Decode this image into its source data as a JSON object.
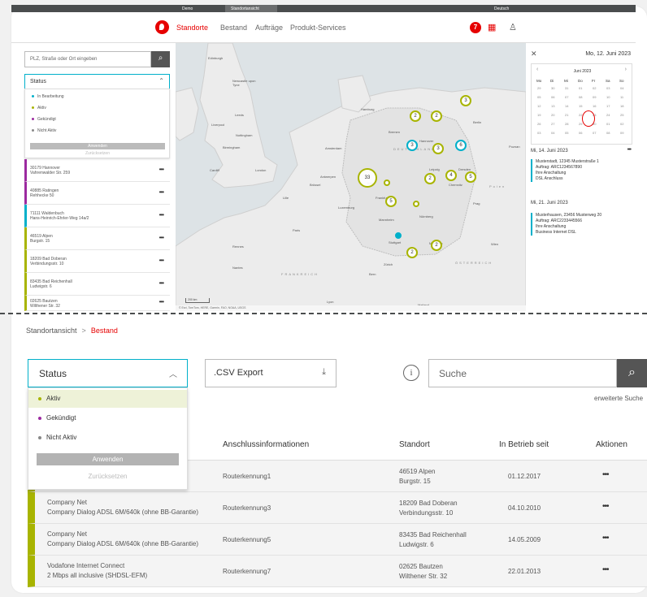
{
  "topbar": {
    "brand": "Demo",
    "tab": "Standortansicht",
    "language": "Deutsch"
  },
  "nav": {
    "items": [
      "Standorte",
      "Bestand",
      "Aufträge",
      "Produkt-Services"
    ],
    "badge_count": "7",
    "colors": {
      "brand": "#e60000",
      "accent": "#00b0ca",
      "active_green": "#a8b400",
      "cancelled_purple": "#9c2aa0"
    }
  },
  "mini": {
    "search_placeholder": "PLZ, Straße oder Ort eingeben",
    "status_label": "Status",
    "status_options": [
      "In Bearbeitung",
      "Aktiv",
      "Gekündigt",
      "Nicht Aktiv"
    ],
    "apply": "Anwenden",
    "reset": "Zurücksetzen",
    "locations": [
      {
        "l1": "30179 Hannover",
        "l2": "Vahrenwalder Str. 259"
      },
      {
        "l1": "40885 Ratingen",
        "l2": "Rehhecke 50"
      },
      {
        "l1": "71111 Waldenbuch",
        "l2": "Hans-Heinrich-Ehrler-Weg 14a/2"
      },
      {
        "l1": "46519 Alpen",
        "l2": "Burgstr. 15"
      },
      {
        "l1": "18209 Bad Doberan",
        "l2": "Verbindungsstr. 10"
      },
      {
        "l1": "83435 Bad Reichenhall",
        "l2": "Ludwigstr. 6"
      },
      {
        "l1": "02625 Bautzen",
        "l2": "Wilthener Str. 32"
      }
    ]
  },
  "map": {
    "labels": [
      "Edinburgh",
      "Newcastle upon Tyne",
      "Leeds",
      "Liverpool",
      "Nottingham",
      "Birmingham",
      "Cardiff",
      "London",
      "Hamburg",
      "Bremen",
      "Berlin",
      "Hannover",
      "Amsterdam",
      "Antwerpen",
      "Brüssel",
      "Köln",
      "Frankfurt",
      "Prag",
      "Paris",
      "Mannheim",
      "Nürnberg",
      "München",
      "Zürich",
      "Wien",
      "Lyon",
      "Mailand",
      "Rennes",
      "Nantes",
      "Bern",
      "DEUTSCHLAND",
      "FRANKREICH",
      "ÖSTERREICH",
      "Poznan",
      "Polen",
      "Leipzig",
      "Dresden",
      "Luxemburg",
      "Stuttgart",
      "Chemnitz",
      "Lille"
    ],
    "clusters": [
      "3",
      "2",
      "2",
      "3",
      "3",
      "6",
      "33",
      "4",
      "5",
      "5",
      "2",
      "2",
      "2"
    ],
    "scale": "200 km",
    "attribution": "© Esri, TomTom, HERE, Garmin, FAO, NOAA, USGS"
  },
  "calendar": {
    "selected": "Mo, 12. Juni 2023",
    "month": "Juni 2023",
    "weekdays": [
      "Mo",
      "Di",
      "Mi",
      "Do",
      "Fr",
      "Sa",
      "So"
    ],
    "days": [
      [
        "29",
        "30",
        "31",
        "01",
        "02",
        "03",
        "04"
      ],
      [
        "05",
        "06",
        "07",
        "08",
        "09",
        "10",
        "11"
      ],
      [
        "12",
        "13",
        "14",
        "15",
        "16",
        "17",
        "18"
      ],
      [
        "19",
        "20",
        "21",
        "22",
        "23",
        "24",
        "25"
      ],
      [
        "26",
        "27",
        "28",
        "29",
        "30",
        "01",
        "02"
      ],
      [
        "03",
        "04",
        "05",
        "06",
        "07",
        "08",
        "09"
      ]
    ],
    "events": [
      {
        "date": "Mi, 14. Juni 2023",
        "lines": [
          "Musterstadt, 12345 Musterstraße 1",
          "Auftrag: ARC1234567890",
          "Ihre Anschaltung",
          "DSL Anschluss"
        ]
      },
      {
        "date": "Mi, 21. Juni 2023",
        "lines": [
          "Musterhausen, 23456 Musterweg 20",
          "Auftrag: ARC2233445566",
          "Ihre Anschaltung",
          "Business Internet DSL"
        ]
      }
    ]
  },
  "bestand": {
    "breadcrumb": [
      "Standortansicht",
      "Bestand"
    ],
    "status_label": "Status",
    "status_options": [
      "Aktiv",
      "Gekündigt",
      "Nicht Aktiv"
    ],
    "apply": "Anwenden",
    "reset": "Zurücksetzen",
    "csv_label": ".CSV Export",
    "search_placeholder": "Suche",
    "advanced_search": "erweiterte Suche",
    "columns": [
      "Anschlussinformationen",
      "Standort",
      "In Betrieb seit",
      "Aktionen"
    ],
    "rows": [
      {
        "product1": "",
        "product2": "",
        "router": "Routerkennung1",
        "loc1": "46519 Alpen",
        "loc2": "Burgstr. 15",
        "since": "01.12.2017"
      },
      {
        "product1": "Company Net",
        "product2": "Company Dialog ADSL 6M/640k (ohne BB-Garantie)",
        "router": "Routerkennung3",
        "loc1": "18209 Bad Doberan",
        "loc2": "Verbindungsstr. 10",
        "since": "04.10.2010"
      },
      {
        "product1": "Company Net",
        "product2": "Company Dialog ADSL 6M/640k (ohne BB-Garantie)",
        "router": "Routerkennung5",
        "loc1": "83435 Bad Reichenhall",
        "loc2": "Ludwigstr. 6",
        "since": "14.05.2009"
      },
      {
        "product1": "Vodafone Internet Connect",
        "product2": "2 Mbps all inclusive (SHDSL-EFM)",
        "router": "Routerkennung7",
        "loc1": "02625 Bautzen",
        "loc2": "Wilthener Str. 32",
        "since": "22.01.2013"
      }
    ]
  }
}
